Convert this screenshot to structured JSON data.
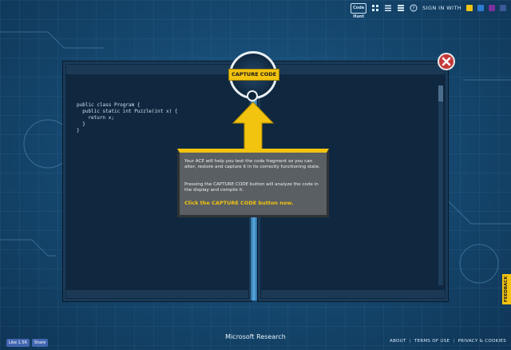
{
  "topbar": {
    "logo": "Code Hunt",
    "sign_in": "SIGN IN WITH",
    "icons": [
      "grid-icon",
      "list-icon",
      "menu-icon",
      "help-icon"
    ],
    "social_colors": [
      "#f2c30f",
      "#2b7cd3",
      "#00a4ef",
      "#7b2fa1",
      "#3b5998"
    ]
  },
  "editor": {
    "code": "public class Program {\n  public static int Puzzle(int x) {\n    return x;\n  }\n}"
  },
  "capture": {
    "label": "CAPTURE CODE"
  },
  "tooltip": {
    "p1": "Your ACE will help you test the code fragment so you can alter, restore and capture it in its correctly functioning state.",
    "p2": "Pressing the CAPTURE CODE button will analyze the code in the display and compile it.",
    "cta": "Click the CAPTURE CODE button now."
  },
  "feedback": {
    "label": "FEEDBACK"
  },
  "bottom": {
    "like_label": "Like 1.5K",
    "share_label": "Share",
    "brand": "Microsoft Research",
    "links": [
      "ABOUT",
      "TERMS OF USE",
      "PRIVACY & COOKIES"
    ]
  },
  "colors": {
    "accent": "#f2c30f",
    "background": "#164a72",
    "panel": "#10283f",
    "close": "#c63a3a"
  }
}
